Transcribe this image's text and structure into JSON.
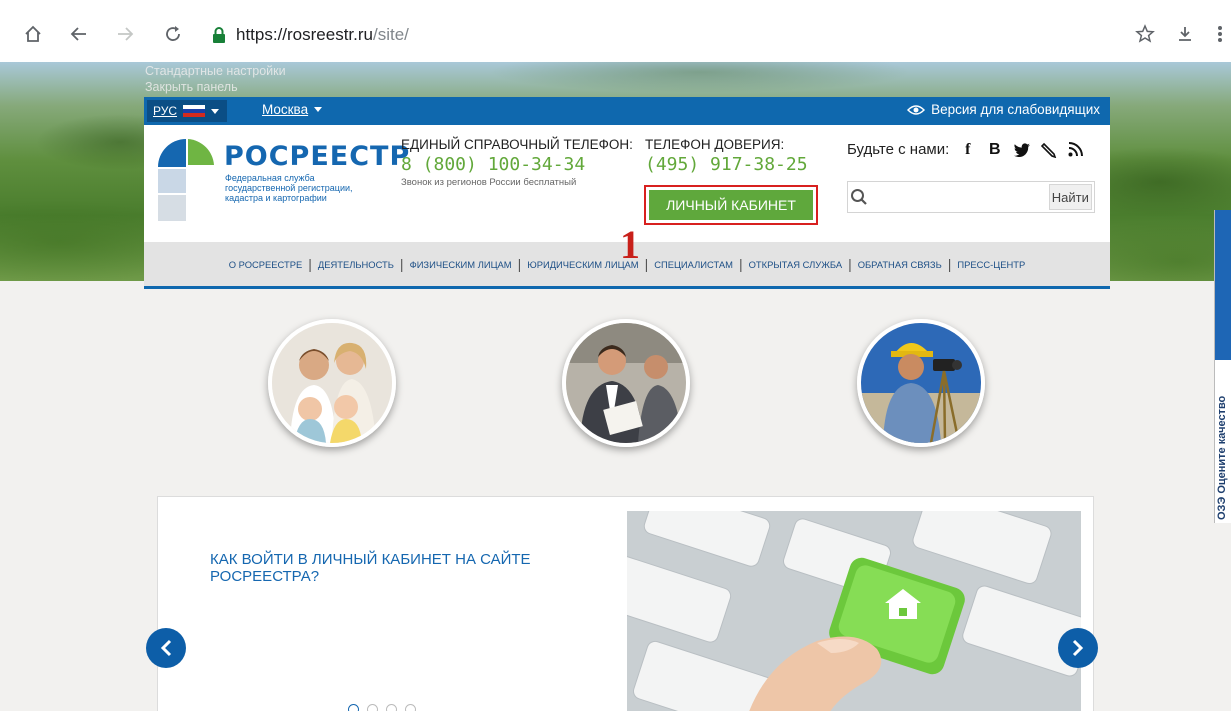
{
  "browser": {
    "url_host": "https://rosreestr.ru",
    "url_path": "/site/"
  },
  "accessibility_panel": {
    "settings_link": "Стандартные настройки",
    "close_link": "Закрыть панель"
  },
  "topbar": {
    "language": "РУС",
    "city": "Москва",
    "vision_version": "Версия для слабовидящих"
  },
  "brand": {
    "name": "РОСРЕЕСТР",
    "subtitle": "Федеральная служба государственной регистрации, кадастра и картографии"
  },
  "phones": {
    "help_label": "ЕДИНЫЙ СПРАВОЧНЫЙ ТЕЛЕФОН:",
    "help_number": "8 (800) 100-34-34",
    "help_note": "Звонок из регионов России бесплатный",
    "trust_label": "ТЕЛЕФОН ДОВЕРИЯ:",
    "trust_number": "(495) 917-38-25"
  },
  "cabinet": {
    "label": "ЛИЧНЫЙ КАБИНЕТ",
    "step_number": "1"
  },
  "social": {
    "label": "Будьте с нами:",
    "icons": [
      "facebook-icon",
      "vk-icon",
      "twitter-icon",
      "livejournal-icon",
      "rss-icon"
    ]
  },
  "search": {
    "placeholder": "",
    "button": "Найти"
  },
  "nav": {
    "items": [
      "О РОСРЕЕСТРЕ",
      "ДЕЯТЕЛЬНОСТЬ",
      "ФИЗИЧЕСКИМ ЛИЦАМ",
      "ЮРИДИЧЕСКИМ ЛИЦАМ",
      "СПЕЦИАЛИСТАМ",
      "ОТКРЫТАЯ СЛУЖБА",
      "ОБРАТНАЯ СВЯЗЬ",
      "ПРЕСС-ЦЕНТР"
    ]
  },
  "categories": [
    "family-photo",
    "business-photo",
    "surveyor-photo"
  ],
  "slider": {
    "title": "КАК ВОЙТИ В ЛИЧНЫЙ КАБИНЕТ НА САЙТЕ РОСРЕЕСТРА?",
    "dot_count": 4,
    "active_dot": 0
  },
  "side_tab": {
    "text": "ОЗЭ Оцените качество"
  },
  "colors": {
    "brand_blue": "#1567b0",
    "topbar_blue": "#0f68ae",
    "accent_green": "#5fa83c",
    "highlight_red": "#d8201f"
  }
}
